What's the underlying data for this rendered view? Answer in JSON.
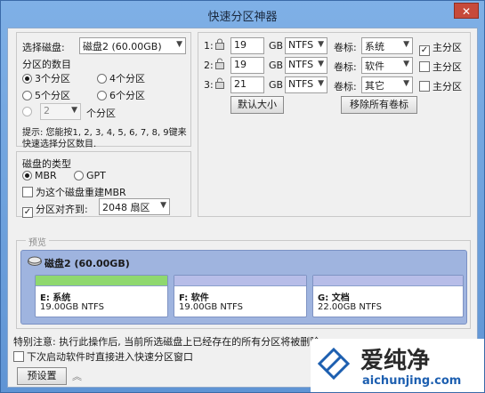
{
  "window": {
    "title": "快速分区神器",
    "close": "✕"
  },
  "disk_select": {
    "label": "选择磁盘:",
    "value": "磁盘2 (60.00GB)"
  },
  "partition_count": {
    "label": "分区的数目",
    "options": [
      "3个分区",
      "4个分区",
      "5个分区",
      "6个分区"
    ],
    "selected": "3个分区",
    "custom_value": "2",
    "custom_suffix": "个分区"
  },
  "hint": {
    "line1": "提示: 您能按1, 2, 3, 4, 5, 6, 7, 8, 9键来",
    "line2": "快速选择分区数目."
  },
  "disk_type": {
    "label": "磁盘的类型",
    "mbr": "MBR",
    "gpt": "GPT",
    "selected": "MBR",
    "rebuild_mbr": "为这个磁盘重建MBR",
    "rebuild_checked": false,
    "align_label": "分区对齐到:",
    "align_checked": true,
    "align_value": "2048 扇区"
  },
  "partitions": [
    {
      "index": "1:",
      "size": "19",
      "unit": "GB",
      "fs": "NTFS",
      "volume_label": "卷标:",
      "volume": "系统",
      "primary_label": "主分区",
      "primary": true
    },
    {
      "index": "2:",
      "size": "19",
      "unit": "GB",
      "fs": "NTFS",
      "volume_label": "卷标:",
      "volume": "软件",
      "primary_label": "主分区",
      "primary": false
    },
    {
      "index": "3:",
      "size": "21",
      "unit": "GB",
      "fs": "NTFS",
      "volume_label": "卷标:",
      "volume": "其它",
      "primary_label": "主分区",
      "primary": false
    }
  ],
  "buttons": {
    "default_size": "默认大小",
    "remove_labels": "移除所有卷标",
    "preset": "预设置"
  },
  "preview": {
    "legend": "预览",
    "disk_label": "磁盘2 (60.00GB)",
    "parts": [
      {
        "name": "E: 系统",
        "info": "19.00GB NTFS",
        "color": "#8fd86f"
      },
      {
        "name": "F: 软件",
        "info": "19.00GB NTFS",
        "color": "#b7bde8"
      },
      {
        "name": "G: 文档",
        "info": "22.00GB NTFS",
        "color": "#b7bde8"
      }
    ]
  },
  "notice": "特别注意: 执行此操作后, 当前所选磁盘上已经存在的所有分区将被删除",
  "startup_option": "下次启动软件时直接进入快速分区窗口",
  "watermark": {
    "brand": "爱纯净",
    "url": "aichunjing.com"
  }
}
